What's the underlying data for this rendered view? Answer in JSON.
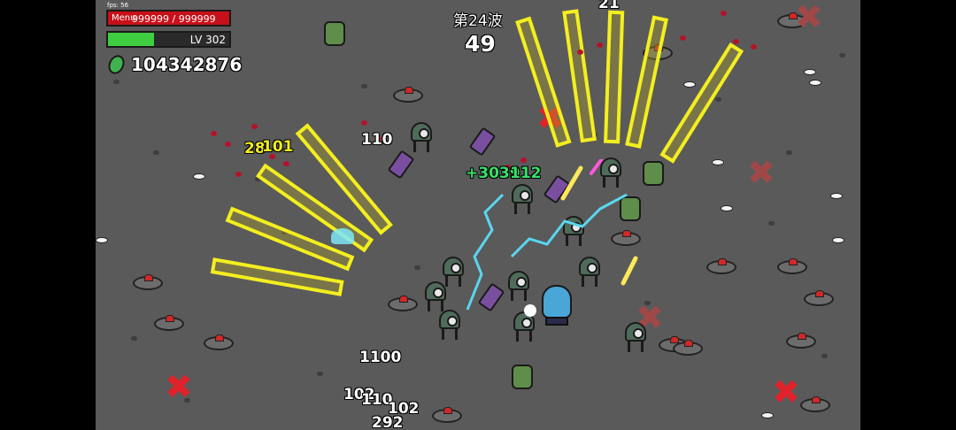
{
  "hud": {
    "fps": "fps: 56",
    "menu_label": "Menu",
    "hp_text": "999999 / 999999",
    "hp_fraction": 1.0,
    "level_text": "LV 302",
    "xp_fraction": 0.38,
    "gem_count": "104342876",
    "wave_label": "第24波",
    "timer": "49"
  },
  "damage_numbers": [
    "21",
    "110",
    "28",
    "101",
    "+3039",
    "112",
    "1100",
    "102",
    "110",
    "102",
    "292"
  ],
  "colors": {
    "arena": "#5a5a5a",
    "hp": "#c8101a",
    "xp": "#3fce3f",
    "gem": "#3fb34f",
    "blade": "#f3ee1f",
    "heal_text": "#38e06a",
    "crit_text": "#f3ee1f",
    "marker_x": "#e0222a"
  },
  "icons": {
    "gem": "green-gem-icon",
    "mine": "landmine-icon",
    "enemy": "one-eyed-robot-icon",
    "marker": "red-x-marker-icon"
  }
}
